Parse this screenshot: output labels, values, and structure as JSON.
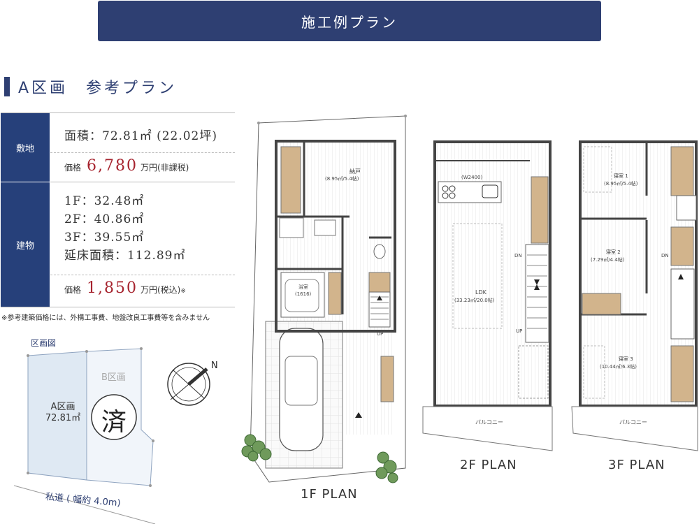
{
  "banner": {
    "title": "施工例プラン"
  },
  "heading": {
    "title": "A区画　参考プラン"
  },
  "spec": {
    "land_label": "敷地",
    "land_area": "面積：72.81㎡ (22.02坪)",
    "land_price_label": "価格",
    "land_price_value": "6,780",
    "land_price_unit": "万円(非課税)",
    "building_label": "建物",
    "floor_1": "1F：32.48㎡",
    "floor_2": "2F：40.86㎡",
    "floor_3": "3F：39.55㎡",
    "total_floor": "延床面積：112.89㎡",
    "building_price_label": "価格",
    "building_price_value": "1,850",
    "building_price_unit": "万円(税込)",
    "building_price_mark": "※"
  },
  "note": "※参考建築価格には、外構工事費、地盤改良工事費等を含みません",
  "site_map": {
    "title": "区画図",
    "lot_a_name": "A区画",
    "lot_a_area": "72.81㎡",
    "lot_b_name": "B区画",
    "sold_stamp": "済",
    "road_label": "私道 ( 幅約 4.0m)",
    "compass": "N"
  },
  "plan_1f": {
    "title": "1F PLAN",
    "storage": "納戸",
    "storage_area": "(8.95㎡/5.4帖)",
    "bath": "浴室",
    "bath_size": "(1616)",
    "up": "UP"
  },
  "plan_2f": {
    "title": "2F PLAN",
    "kitchen": "(W2400)",
    "ldk": "LDK",
    "ldk_area": "(33.23㎡/20.0帖)",
    "dn": "DN",
    "up": "UP",
    "balcony": "バルコニー"
  },
  "plan_3f": {
    "title": "3F PLAN",
    "room1": "寝室 1",
    "room1_area": "(8.95㎡/5.4帖)",
    "room2": "寝室 2",
    "room2_area": "(7.29㎡/4.4帖)",
    "room3": "寝室 3",
    "room3_area": "(10.44㎡/6.3帖)",
    "dn": "DN",
    "balcony": "バルコニー"
  },
  "colors": {
    "navy": "#2e3f72",
    "price_red": "#a6232e",
    "wood": "#d2b48c",
    "lot_a": "#dfe9f3"
  }
}
